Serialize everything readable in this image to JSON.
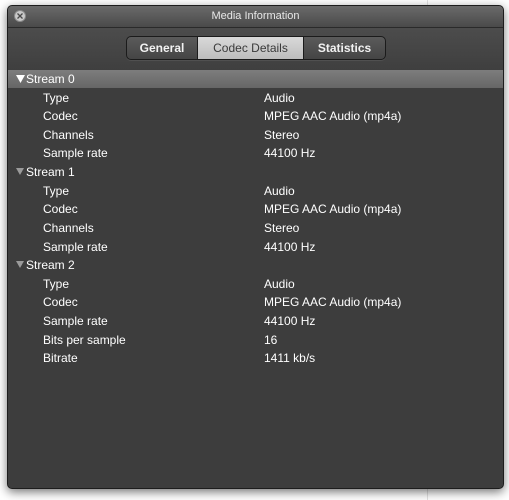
{
  "window": {
    "title": "Media Information"
  },
  "tabs": [
    {
      "label": "General",
      "selected": false
    },
    {
      "label": "Codec Details",
      "selected": true
    },
    {
      "label": "Statistics",
      "selected": false
    }
  ],
  "streams": [
    {
      "label": "Stream 0",
      "expanded": true,
      "rows": [
        {
          "key": "Type",
          "value": "Audio"
        },
        {
          "key": "Codec",
          "value": "MPEG AAC Audio (mp4a)"
        },
        {
          "key": "Channels",
          "value": "Stereo"
        },
        {
          "key": "Sample rate",
          "value": "44100 Hz"
        }
      ]
    },
    {
      "label": "Stream 1",
      "expanded": true,
      "rows": [
        {
          "key": "Type",
          "value": "Audio"
        },
        {
          "key": "Codec",
          "value": "MPEG AAC Audio (mp4a)"
        },
        {
          "key": "Channels",
          "value": "Stereo"
        },
        {
          "key": "Sample rate",
          "value": "44100 Hz"
        }
      ]
    },
    {
      "label": "Stream 2",
      "expanded": true,
      "rows": [
        {
          "key": "Type",
          "value": "Audio"
        },
        {
          "key": "Codec",
          "value": "MPEG AAC Audio (mp4a)"
        },
        {
          "key": "Sample rate",
          "value": "44100 Hz"
        },
        {
          "key": "Bits per sample",
          "value": "16"
        },
        {
          "key": "Bitrate",
          "value": "1411 kb/s"
        }
      ]
    }
  ]
}
